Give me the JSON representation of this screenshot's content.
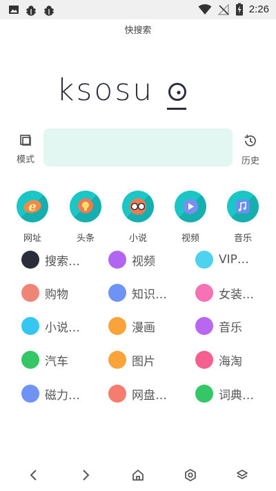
{
  "status_bar": {
    "time": "2:26",
    "icons": [
      "image-icon",
      "bug-icon",
      "bug-icon",
      "wifi-icon",
      "no-signal-icon",
      "battery-charging-icon"
    ]
  },
  "app": {
    "title": "快搜索"
  },
  "logo": {
    "text": "ksosu"
  },
  "search": {
    "mode_label": "模式",
    "history_label": "历史",
    "value": "",
    "placeholder": ""
  },
  "shortcuts": [
    {
      "label": "网址",
      "icon": "ie-browser-icon"
    },
    {
      "label": "头条",
      "icon": "lightbulb-icon"
    },
    {
      "label": "小说",
      "icon": "glasses-icon"
    },
    {
      "label": "视频",
      "icon": "film-play-icon"
    },
    {
      "label": "音乐",
      "icon": "music-note-icon"
    }
  ],
  "categories": [
    {
      "label": "搜索…",
      "color": "#2b2d3a"
    },
    {
      "label": "视频",
      "color": "#b165f0"
    },
    {
      "label": "VIP…",
      "color": "#4dd3ef"
    },
    {
      "label": "购物",
      "color": "#ef8577"
    },
    {
      "label": "知识…",
      "color": "#6f93f5"
    },
    {
      "label": "女装…",
      "color": "#f771b5"
    },
    {
      "label": "小说…",
      "color": "#35c7f2"
    },
    {
      "label": "漫画",
      "color": "#fba33b"
    },
    {
      "label": "音乐",
      "color": "#b967f0"
    },
    {
      "label": "汽车",
      "color": "#35c765"
    },
    {
      "label": "图片",
      "color": "#fba33b"
    },
    {
      "label": "海淘",
      "color": "#f5608f"
    },
    {
      "label": "磁力…",
      "color": "#6f93f5"
    },
    {
      "label": "网盘…",
      "color": "#f57c6e"
    },
    {
      "label": "词典…",
      "color": "#35c765"
    }
  ],
  "colors": {
    "accent_teal": "#1ac6c6",
    "search_bg": "#e2f6f2"
  },
  "bottom_nav": [
    "back-icon",
    "forward-icon",
    "home-icon",
    "settings-icon",
    "layers-icon"
  ]
}
